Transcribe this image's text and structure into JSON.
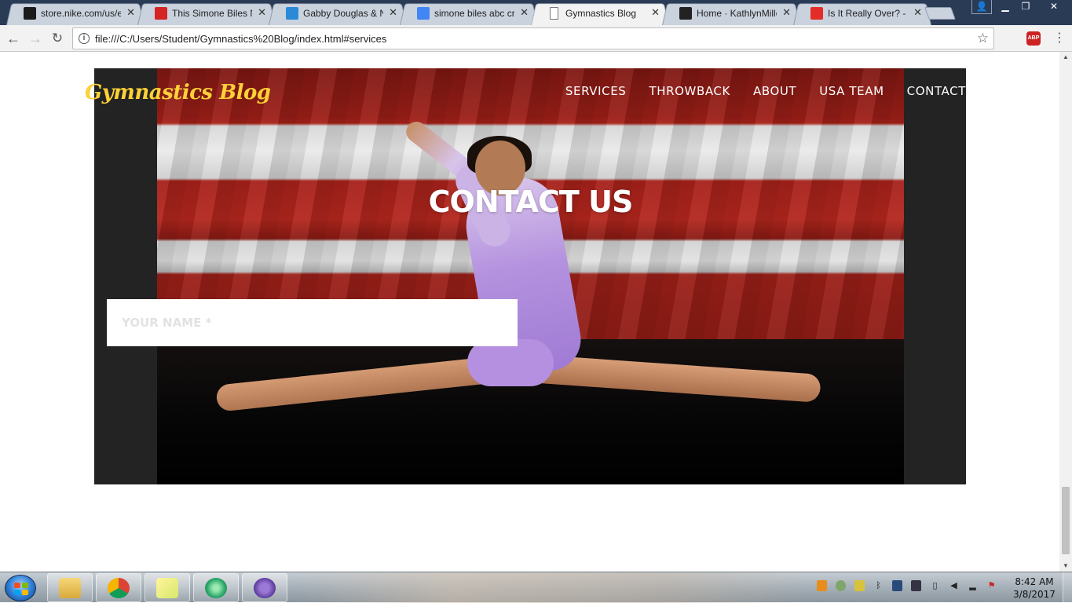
{
  "browser": {
    "tabs": [
      {
        "title": "store.nike.com/us/e",
        "favicon": "nike-icon",
        "color": "#1b1b1b",
        "active": false
      },
      {
        "title": "This Simone Biles N",
        "favicon": "news-icon",
        "color": "#d32323",
        "active": false
      },
      {
        "title": "Gabby Douglas & N",
        "favicon": "bookmark-icon",
        "color": "#2b8ad8",
        "active": false
      },
      {
        "title": "simone biles abc cr",
        "favicon": "google-icon",
        "color": "#4285f4",
        "active": false
      },
      {
        "title": "Gymnastics Blog",
        "favicon": "document-icon",
        "color": "#ffffff",
        "active": true
      },
      {
        "title": "Home · KathlynMille",
        "favicon": "github-icon",
        "color": "#222222",
        "active": false
      },
      {
        "title": "Is It Really Over? - Y",
        "favicon": "youtube-icon",
        "color": "#e52d27",
        "active": false
      }
    ],
    "close_glyph": "✕",
    "url": "file:///C:/Users/Student/Gymnastics%20Blog/index.html#services",
    "extension_label": "ABP"
  },
  "site": {
    "brand": "Gymnastics Blog",
    "nav": [
      "SERVICES",
      "THROWBACK",
      "ABOUT",
      "USA TEAM",
      "CONTACT"
    ],
    "section_title": "CONTACT US",
    "name_placeholder": "YOUR NAME *",
    "accent_color": "#fed136"
  },
  "taskbar": {
    "apps": [
      "windows-explorer-icon",
      "chrome-icon",
      "sticky-notes-icon",
      "atom-icon",
      "github-desktop-icon"
    ],
    "time": "8:42 AM",
    "date": "3/8/2017"
  }
}
